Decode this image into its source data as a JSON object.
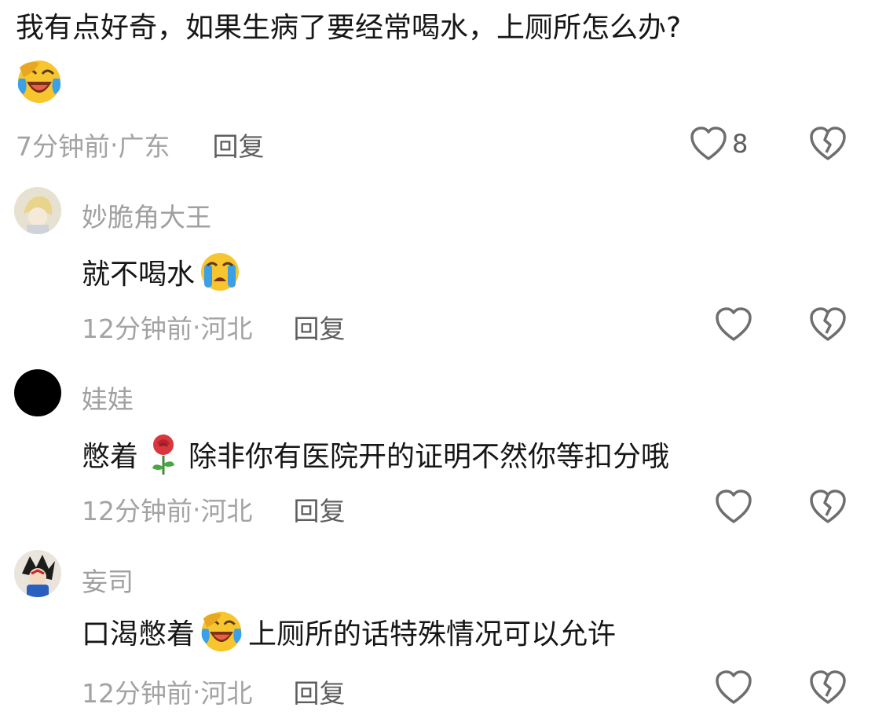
{
  "root_comment": {
    "text": "我有点好奇，如果生病了要经常喝水，上厕所怎么办?",
    "emoji_name": "cry-laughing-emoji",
    "time": "7分钟前",
    "location": "广东",
    "reply_label": "回复",
    "like_count": "8"
  },
  "replies": [
    {
      "username": "妙脆角大王",
      "text_before": "就不喝水",
      "emoji_name": "crying-emoji",
      "text_after": "",
      "time": "12分钟前",
      "location": "河北",
      "reply_label": "回复"
    },
    {
      "username": "娃娃",
      "text_before": "憋着",
      "emoji_name": "rose-emoji",
      "text_after": "除非你有医院开的证明不然你等扣分哦",
      "time": "12分钟前",
      "location": "河北",
      "reply_label": "回复"
    },
    {
      "username": "妄司",
      "text_before": "口渴憋着",
      "emoji_name": "cry-laughing-emoji",
      "text_after": "上厕所的话特殊情况可以允许",
      "time": "12分钟前",
      "location": "河北",
      "reply_label": "回复"
    }
  ],
  "separator": " · ",
  "colors": {
    "text": "#161616",
    "meta": "#a3a3a3",
    "reply": "#5e5e5e",
    "icon": "#6e6e6e",
    "emoji_face": "#f7c52e",
    "emoji_tear": "#3aa0e8"
  }
}
